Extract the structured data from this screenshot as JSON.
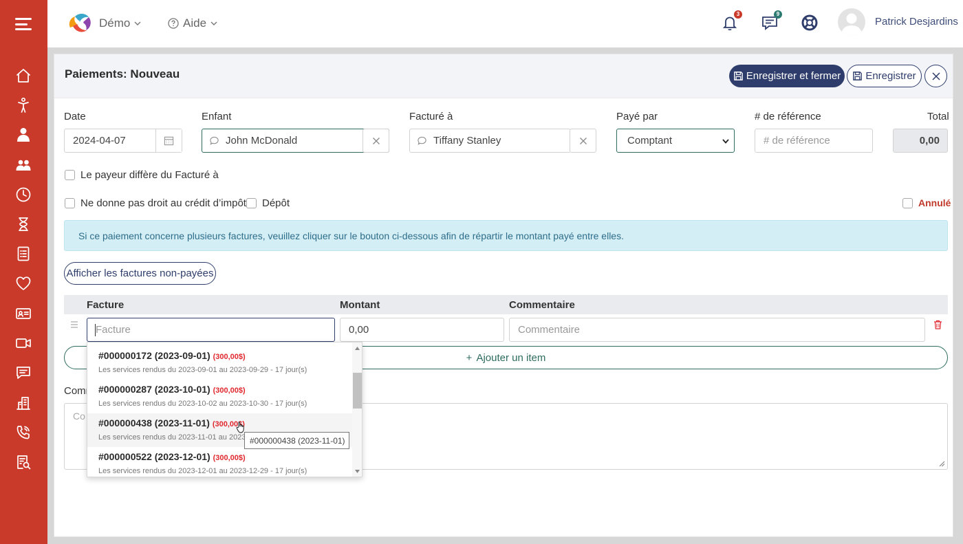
{
  "topbar": {
    "app_menu": "Démo",
    "help_menu": "Aide",
    "notifications_count": "3",
    "messages_count": "9",
    "username": "Patrick Desjardins"
  },
  "sidebar": {
    "items": [
      {
        "icon": "home-icon"
      },
      {
        "icon": "child-icon"
      },
      {
        "icon": "staff-icon"
      },
      {
        "icon": "group-icon"
      },
      {
        "icon": "clock-icon"
      },
      {
        "icon": "hourglass-icon"
      },
      {
        "icon": "invoice-icon"
      },
      {
        "icon": "heart-icon"
      },
      {
        "icon": "id-card-icon"
      },
      {
        "icon": "video-icon"
      },
      {
        "icon": "chat-icon"
      },
      {
        "icon": "building-icon"
      },
      {
        "icon": "phone-icon"
      },
      {
        "icon": "report-icon"
      }
    ]
  },
  "panel": {
    "title": "Paiements: Nouveau",
    "save_close_label": "Enregistrer et fermer",
    "save_label": "Enregistrer"
  },
  "form": {
    "date_label": "Date",
    "date_value": "2024-04-07",
    "child_label": "Enfant",
    "child_value": "John McDonald",
    "billed_label": "Facturé à",
    "billed_value": "Tiffany Stanley",
    "paid_by_label": "Payé par",
    "paid_by_value": "Comptant",
    "ref_label": "# de référence",
    "ref_placeholder": "# de référence",
    "total_label": "Total",
    "total_value": "0,00",
    "payer_differs_label": "Le payeur diffère du Facturé à",
    "no_tax_credit_label": "Ne donne pas droit au crédit d’impôt",
    "deposit_label": "Dépôt",
    "cancelled_label": "Annulé",
    "info_text": "Si ce paiement concerne plusieurs factures, veuillez cliquer sur le bouton ci-dessous afin de répartir le montant payé entre elles.",
    "show_unpaid_label": "Afficher les factures non-payées",
    "add_item_label": "Ajouter un item",
    "comment_label_partial": "Comm",
    "comment_placeholder_partial": "Co"
  },
  "table": {
    "headers": [
      "Facture",
      "Montant",
      "Commentaire"
    ],
    "row": {
      "invoice_placeholder": "Facture",
      "amount_value": "0,00",
      "comment_placeholder": "Commentaire"
    }
  },
  "dropdown": {
    "items": [
      {
        "title": "#000000172 (2023-09-01)",
        "amount": "(300,00$)",
        "desc": "Les services rendus du 2023-09-01 au 2023-09-29 - 17 jour(s)"
      },
      {
        "title": "#000000287 (2023-10-01)",
        "amount": "(300,00$)",
        "desc": "Les services rendus du 2023-10-02 au 2023-10-30 - 17 jour(s)"
      },
      {
        "title": "#000000438 (2023-11-01)",
        "amount": "(300,00$)",
        "desc": "Les services rendus du 2023-11-01 au 2023"
      },
      {
        "title": "#000000522 (2023-12-01)",
        "amount": "(300,00$)",
        "desc": "Les services rendus du 2023-12-01 au 2023-12-29 - 17 jour(s)"
      }
    ],
    "tooltip": "#000000438 (2023-11-01)"
  },
  "colors": {
    "sidebar": "#c93a2b",
    "primary": "#2e3d6b",
    "accent_green": "#2d6c5e",
    "danger": "#c0392b"
  }
}
